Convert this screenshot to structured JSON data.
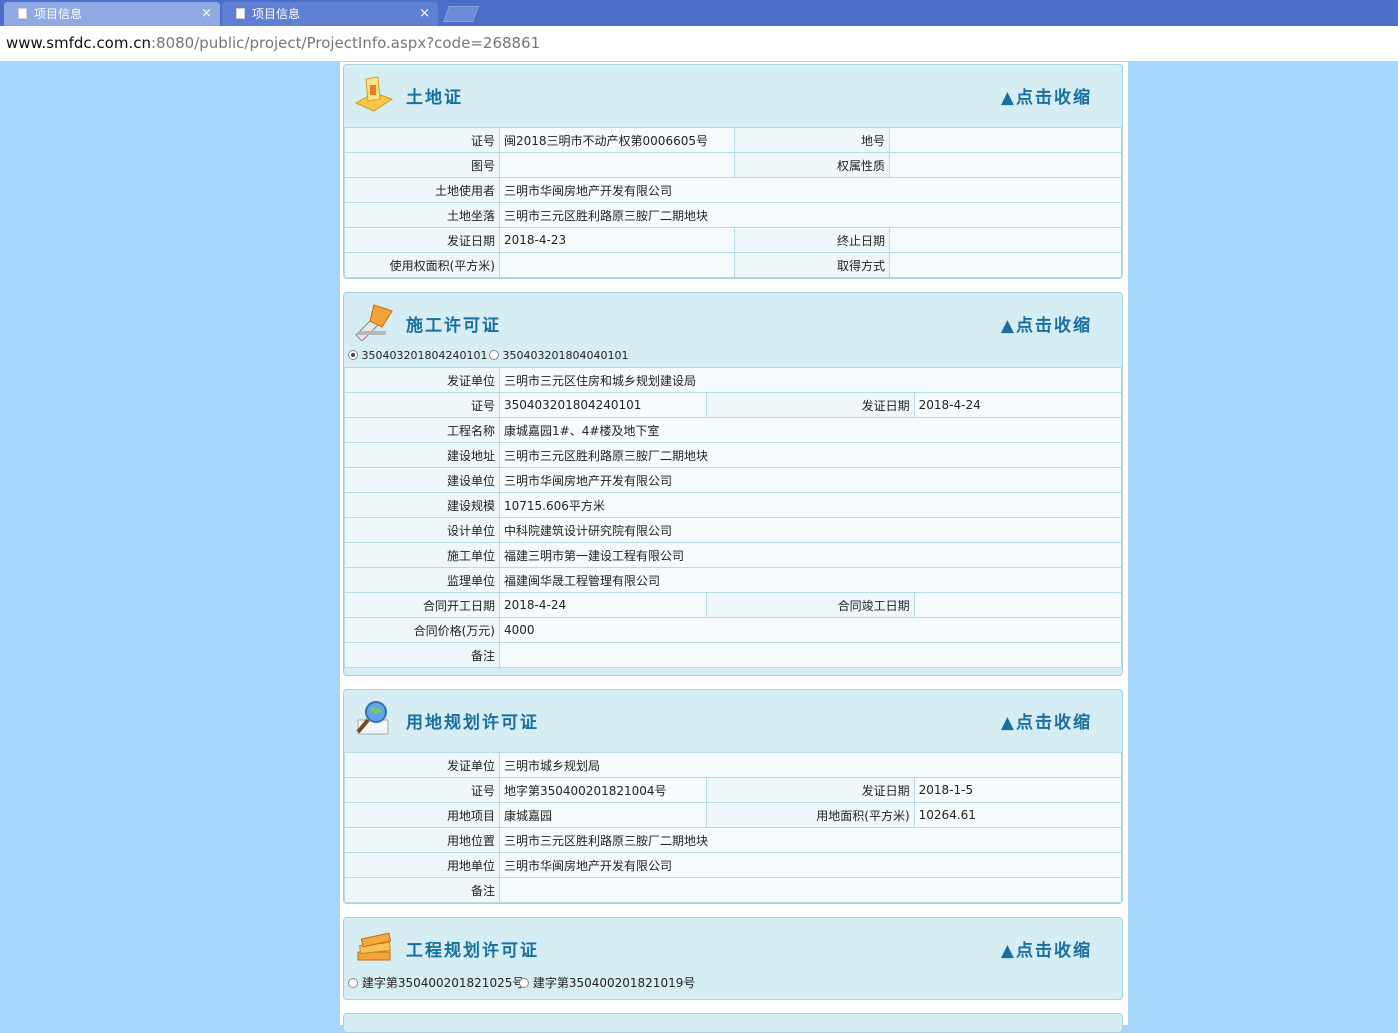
{
  "browser": {
    "tabs": [
      {
        "label": "项目信息",
        "close": "×"
      },
      {
        "label": "项目信息",
        "close": "×"
      }
    ],
    "url_host": "www.smfdc.com.cn",
    "url_rest": ":8080/public/project/ProjectInfo.aspx?code=268861"
  },
  "toggle_label": "▲点击收缩",
  "land_cert": {
    "title": "土地证",
    "cert_no_label": "证号",
    "cert_no": "闽2018三明市不动产权第0006605号",
    "lot_no_label": "地号",
    "lot_no": "",
    "map_no_label": "图号",
    "map_no": "",
    "ownership_label": "权属性质",
    "ownership": "",
    "user_label": "土地使用者",
    "user": "三明市华闽房地产开发有限公司",
    "location_label": "土地坐落",
    "location": "三明市三元区胜利路原三胺厂二期地块",
    "issue_date_label": "发证日期",
    "issue_date": "2018-4-23",
    "end_date_label": "终止日期",
    "end_date": "",
    "area_label": "使用权面积(平方米)",
    "area": "",
    "acquire_label": "取得方式",
    "acquire": ""
  },
  "construction_permit": {
    "title": "施工许可证",
    "radio_options": [
      "350403201804240101",
      "350403201804040101"
    ],
    "issuer_label": "发证单位",
    "issuer": "三明市三元区住房和城乡规划建设局",
    "cert_no_label": "证号",
    "cert_no": "350403201804240101",
    "issue_date_label": "发证日期",
    "issue_date": "2018-4-24",
    "project_label": "工程名称",
    "project": "康城嘉园1#、4#楼及地下室",
    "address_label": "建设地址",
    "address": "三明市三元区胜利路原三胺厂二期地块",
    "builder_label": "建设单位",
    "builder": "三明市华闽房地产开发有限公司",
    "scale_label": "建设规模",
    "scale": "10715.606平方米",
    "designer_label": "设计单位",
    "designer": "中科院建筑设计研究院有限公司",
    "contractor_label": "施工单位",
    "contractor": "福建三明市第一建设工程有限公司",
    "supervisor_label": "监理单位",
    "supervisor": "福建闽华晟工程管理有限公司",
    "start_label": "合同开工日期",
    "start": "2018-4-24",
    "finish_label": "合同竣工日期",
    "finish": "",
    "price_label": "合同价格(万元)",
    "price": "4000",
    "remark_label": "备注",
    "remark": ""
  },
  "land_planning": {
    "title": "用地规划许可证",
    "issuer_label": "发证单位",
    "issuer": "三明市城乡规划局",
    "cert_no_label": "证号",
    "cert_no": "地字第350400201821004号",
    "issue_date_label": "发证日期",
    "issue_date": "2018-1-5",
    "project_label": "用地项目",
    "project": "康城嘉园",
    "area_label": "用地面积(平方米)",
    "area": "10264.61",
    "location_label": "用地位置",
    "location": "三明市三元区胜利路原三胺厂二期地块",
    "unit_label": "用地单位",
    "unit": "三明市华闽房地产开发有限公司",
    "remark_label": "备注",
    "remark": ""
  },
  "engineering_planning": {
    "title": "工程规划许可证",
    "radio_options": [
      "建字第350400201821025号",
      "建字第350400201821019号"
    ]
  }
}
